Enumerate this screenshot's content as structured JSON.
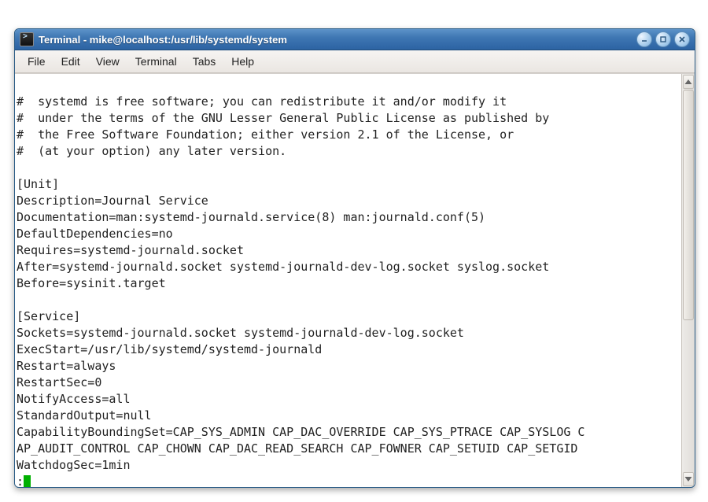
{
  "window": {
    "title": "Terminal - mike@localhost:/usr/lib/systemd/system"
  },
  "menubar": {
    "items": [
      "File",
      "Edit",
      "View",
      "Terminal",
      "Tabs",
      "Help"
    ]
  },
  "terminal": {
    "lines": [
      "#  systemd is free software; you can redistribute it and/or modify it",
      "#  under the terms of the GNU Lesser General Public License as published by",
      "#  the Free Software Foundation; either version 2.1 of the License, or",
      "#  (at your option) any later version.",
      "",
      "[Unit]",
      "Description=Journal Service",
      "Documentation=man:systemd-journald.service(8) man:journald.conf(5)",
      "DefaultDependencies=no",
      "Requires=systemd-journald.socket",
      "After=systemd-journald.socket systemd-journald-dev-log.socket syslog.socket",
      "Before=sysinit.target",
      "",
      "[Service]",
      "Sockets=systemd-journald.socket systemd-journald-dev-log.socket",
      "ExecStart=/usr/lib/systemd/systemd-journald",
      "Restart=always",
      "RestartSec=0",
      "NotifyAccess=all",
      "StandardOutput=null",
      "CapabilityBoundingSet=CAP_SYS_ADMIN CAP_DAC_OVERRIDE CAP_SYS_PTRACE CAP_SYSLOG C",
      "AP_AUDIT_CONTROL CAP_CHOWN CAP_DAC_READ_SEARCH CAP_FOWNER CAP_SETUID CAP_SETGID",
      "WatchdogSec=1min"
    ],
    "prompt": ":"
  },
  "icons": {
    "minimize": "minimize-icon",
    "maximize": "maximize-icon",
    "close": "close-icon",
    "terminal": "terminal-icon",
    "up": "scroll-up-icon",
    "down": "scroll-down-icon"
  }
}
